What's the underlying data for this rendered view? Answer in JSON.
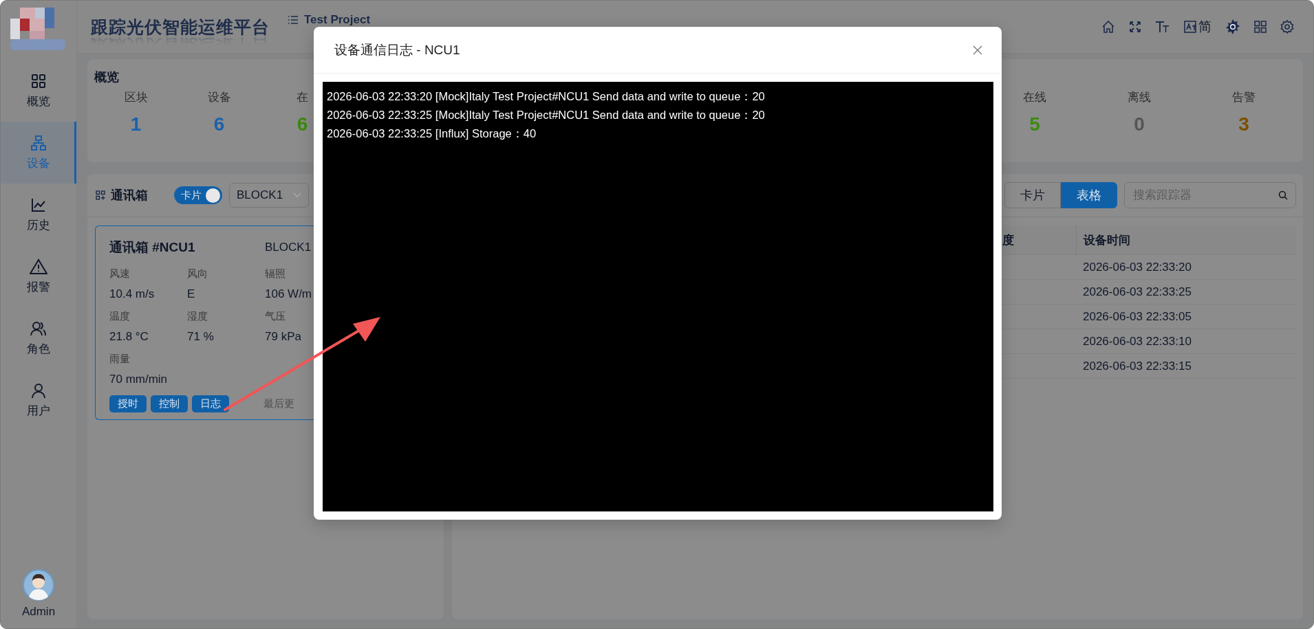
{
  "app": {
    "title": "跟踪光伏智能运维平台",
    "project": "Test Project"
  },
  "sidebar": {
    "items": [
      {
        "label": "概览",
        "kind": "grid",
        "selected": false
      },
      {
        "label": "设备",
        "kind": "network",
        "selected": true
      },
      {
        "label": "历史",
        "kind": "chart",
        "selected": false
      },
      {
        "label": "报警",
        "kind": "alert",
        "selected": false
      },
      {
        "label": "角色",
        "kind": "team",
        "selected": false
      },
      {
        "label": "用户",
        "kind": "user",
        "selected": false
      }
    ],
    "user": "Admin"
  },
  "header_tools": [
    {
      "kind": "home"
    },
    {
      "kind": "fullscreen"
    },
    {
      "kind": "font-size"
    },
    {
      "kind": "translate",
      "label": "简"
    },
    {
      "kind": "theme"
    },
    {
      "kind": "apps"
    },
    {
      "kind": "settings"
    }
  ],
  "overview": {
    "title": "概览",
    "stats_left": [
      {
        "label": "区块",
        "value": "1",
        "color": "#1a62ac"
      },
      {
        "label": "设备",
        "value": "6",
        "color": "#1a62ac"
      },
      {
        "label": "在",
        "value": "6",
        "color": "#3b8a10"
      }
    ],
    "stats_right": [
      {
        "label": "在线",
        "value": "5",
        "color": "#3b8a10"
      },
      {
        "label": "离线",
        "value": "0",
        "color": "#555555"
      },
      {
        "label": "告警",
        "value": "3",
        "color": "#7a5000"
      }
    ]
  },
  "device_panel": {
    "title": "通讯箱",
    "view_switch": {
      "label": "卡片",
      "on": true
    },
    "block_select": {
      "value": "BLOCK1"
    },
    "view_buttons": [
      {
        "label": "卡片",
        "selected": false
      },
      {
        "label": "表格",
        "selected": true
      }
    ],
    "search": {
      "placeholder": "搜索跟踪器"
    },
    "cards": [
      {
        "title": "通讯箱 #NCU1",
        "block": "BLOCK1",
        "metrics": [
          {
            "label": "风速",
            "value": "10.4 m/s"
          },
          {
            "label": "风向",
            "value": "E"
          },
          {
            "label": "辐照",
            "value": "106 W/m"
          },
          {
            "label": "温度",
            "value": "21.8 °C"
          },
          {
            "label": "湿度",
            "value": "71 %"
          },
          {
            "label": "气压",
            "value": "79 kPa"
          },
          {
            "label": "雨量",
            "value": "70 mm/min"
          }
        ],
        "actions": [
          "授时",
          "控制",
          "日志"
        ],
        "footer": "最后更"
      }
    ],
    "table": {
      "columns": [
        {
          "label": "度"
        },
        {
          "label": "设备时间"
        }
      ],
      "rows": [
        {
          "device_time": "2026-06-03 22:33:20"
        },
        {
          "device_time": "2026-06-03 22:33:25"
        },
        {
          "device_time": "2026-06-03 22:33:05"
        },
        {
          "device_time": "2026-06-03 22:33:10"
        },
        {
          "device_time": "2026-06-03 22:33:15"
        }
      ]
    }
  },
  "modal": {
    "title": "设备通信日志 - NCU1",
    "log": [
      "2026-06-03 22:33:20 [Mock]Italy Test Project#NCU1 Send data and write to queue：20",
      "2026-06-03 22:33:25 [Mock]Italy Test Project#NCU1 Send data and write to queue：20",
      "2026-06-03 22:33:25 [Influx] Storage：40"
    ]
  }
}
